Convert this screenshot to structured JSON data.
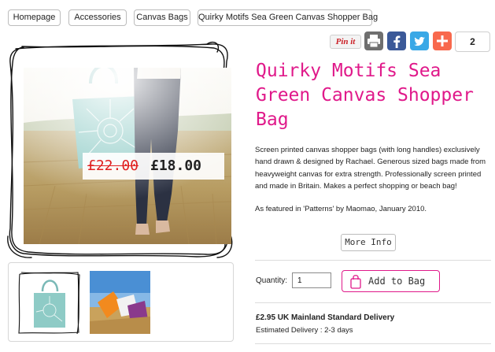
{
  "breadcrumbs": [
    "Homepage",
    "Accessories",
    "Canvas Bags",
    "Quirky Motifs Sea Green Canvas Shopper Bag"
  ],
  "share": {
    "pinterest_label": "Pin it",
    "count": "2",
    "colors": {
      "print": "#6f6f6f",
      "facebook": "#3b5998",
      "twitter": "#3aa8e6",
      "addthis": "#f8694d"
    }
  },
  "product": {
    "title": "Quirky Motifs Sea Green Canvas Shopper Bag",
    "old_price": "£22.00",
    "price": "£18.00",
    "description": [
      "Screen printed canvas shopper bags (with long handles) exclusively hand drawn & designed by Rachael. Generous sized bags made from heavyweight canvas for extra strength. Professionally screen printed and made in Britain.  Makes a perfect shopping or beach bag!",
      "As featured in 'Patterns' by Maomao, January 2010."
    ],
    "more_info_label": "More Info",
    "quantity_label": "Quantity:",
    "quantity_value": "1",
    "add_to_bag_label": "Add to Bag",
    "delivery": "£2.95 UK Mainland Standard Delivery",
    "estimated_delivery": "Estimated Delivery : 2-3 days",
    "accent_color": "#e0198a"
  },
  "thumbnails": [
    "bag-thumbnail",
    "beach-thumbnail"
  ]
}
